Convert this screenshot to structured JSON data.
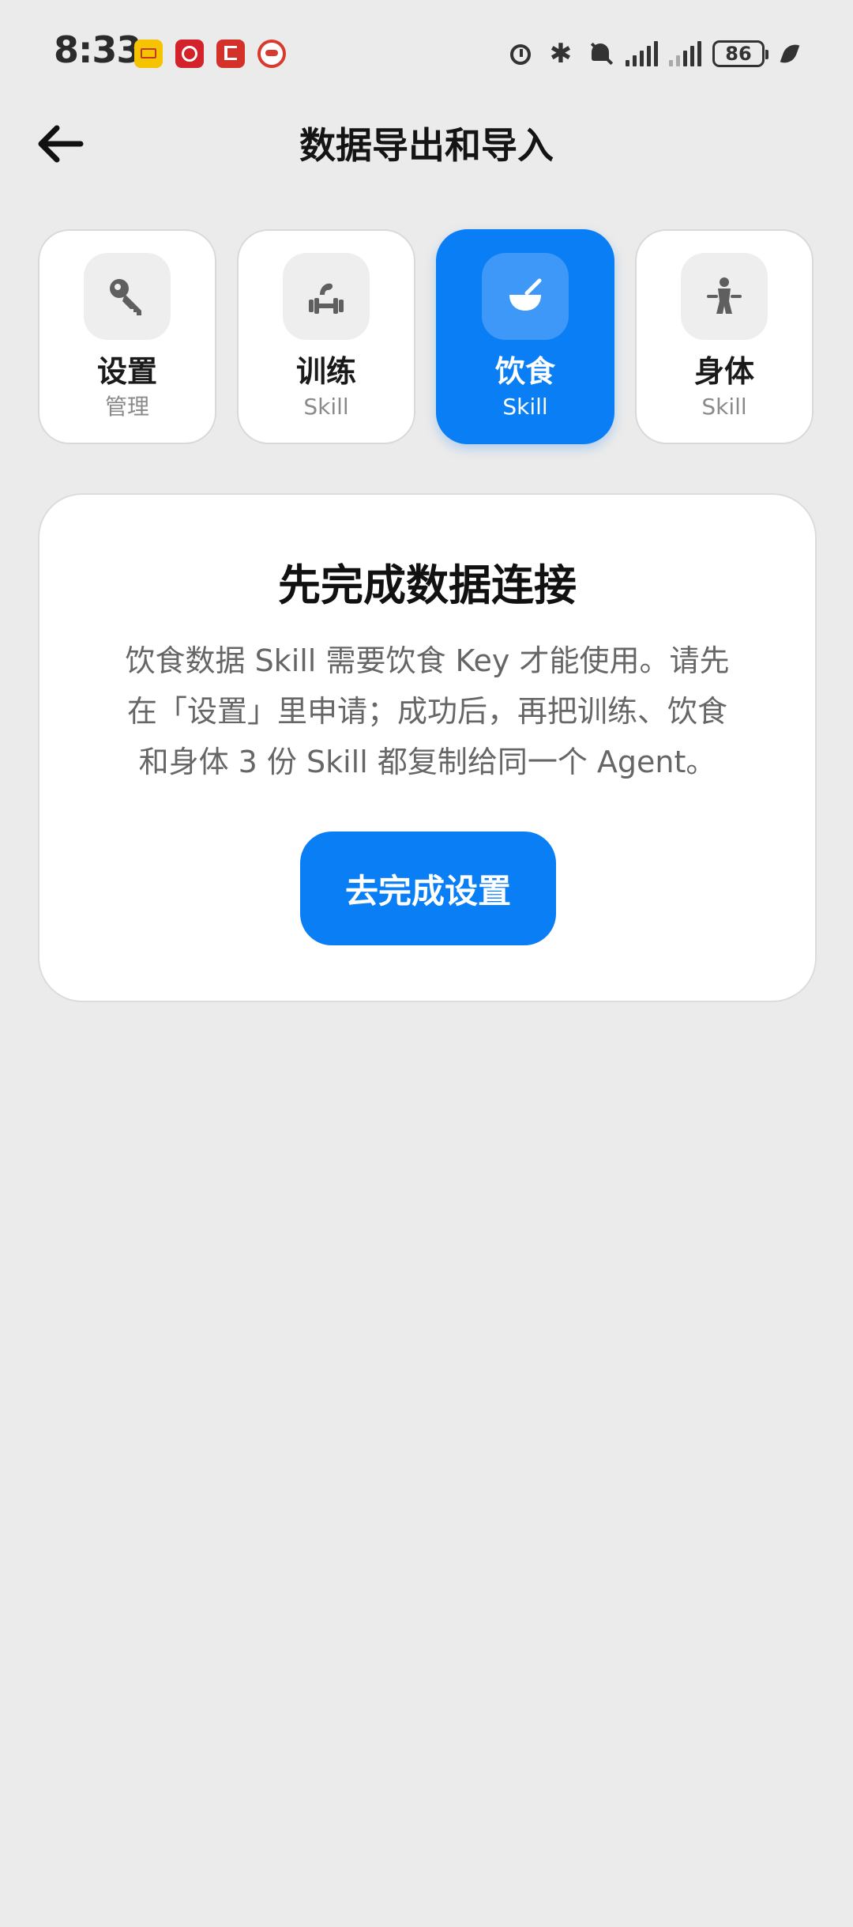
{
  "status_bar": {
    "time": "8:33",
    "bluetooth_glyph": "✱",
    "battery": "86",
    "icons": [
      "mail-app-icon",
      "bank-app-icon",
      "news-app-icon",
      "owl-app-icon",
      "alarm-icon",
      "bluetooth-icon",
      "mute-icon",
      "signal-icon",
      "signal-icon",
      "battery-icon",
      "leaf-icon"
    ]
  },
  "header": {
    "title": "数据导出和导入",
    "back_icon": "arrow-left-icon"
  },
  "tabs": [
    {
      "label": "设置",
      "sub": "管理",
      "icon": "key-icon",
      "active": false
    },
    {
      "label": "训练",
      "sub": "Skill",
      "icon": "dumbbell-icon",
      "active": false
    },
    {
      "label": "饮食",
      "sub": "Skill",
      "icon": "bowl-icon",
      "active": true
    },
    {
      "label": "身体",
      "sub": "Skill",
      "icon": "body-icon",
      "active": false
    }
  ],
  "card": {
    "title": "先完成数据连接",
    "description_lines": [
      "饮食数据 Skill 需要饮食 Key 才能使用。请先",
      "在「设置」里申请；成功后，再把训练、饮食",
      "和身体 3 份 Skill 都复制给同一个 Agent。"
    ],
    "button_label": "去完成设置"
  },
  "colors": {
    "accent": "#0a7ef5",
    "background": "#ebebeb",
    "card": "#ffffff"
  }
}
